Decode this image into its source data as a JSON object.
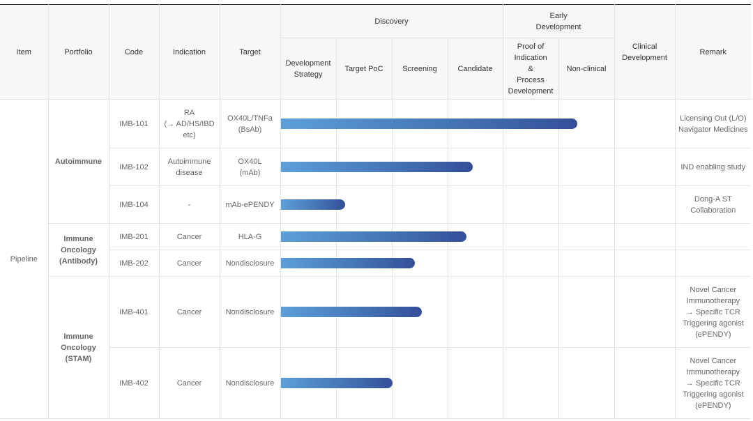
{
  "header": {
    "item": "Item",
    "portfolio": "Portfolio",
    "code": "Code",
    "indication": "Indication",
    "target": "Target",
    "discovery": "Discovery",
    "early_development": "Early\nDevelopment",
    "clinical_development": "Clinical\nDevelopment",
    "remark": "Remark",
    "sub": {
      "development_strategy": "Development\nStrategy",
      "target_poc": "Target PoC",
      "screening": "Screening",
      "candidate": "Candidate",
      "proof_of_indication": "Proof of\nIndication\n&\nProcess\nDevelopment",
      "non_clinical": "Non-clinical"
    }
  },
  "item_label": "Pipeline",
  "portfolios": {
    "autoimmune": "Autoimmune",
    "immune_oncology_antibody": "Immune\nOncology\n(Antibody)",
    "immune_oncology_stam": "Immune\nOncology\n(STAM)"
  },
  "rows": [
    {
      "code": "IMB-101",
      "indication": "RA\n(→ AD/HS/IBD\netc)",
      "target": "OX40L/TNFa\n(BsAb)",
      "remark": "Licensing Out (L/O)\nNavigator Medicines",
      "progress": 0.75
    },
    {
      "code": "IMB-102",
      "indication": "Autoimmune\ndisease",
      "target": "OX40L\n(mAb)",
      "remark": "IND enabling study",
      "progress": 0.485
    },
    {
      "code": "IMB-104",
      "indication": "-",
      "target": "mAb-ePENDY",
      "remark": "Dong-A ST\nCollaboration",
      "progress": 0.163
    },
    {
      "code": "IMB-201",
      "indication": "Cancer",
      "target": "HLA-G",
      "remark": "",
      "progress": 0.47
    },
    {
      "code": "IMB-202",
      "indication": "Cancer",
      "target": "Nondisclosure",
      "remark": "",
      "progress": 0.34
    },
    {
      "code": "IMB-401",
      "indication": "Cancer",
      "target": "Nondisclosure",
      "remark": "Novel Cancer\nImmunotherapy\n→ Specific TCR\nTriggering agonist\n(ePENDY)",
      "progress": 0.356
    },
    {
      "code": "IMB-402",
      "indication": "Cancer",
      "target": "Nondisclosure",
      "remark": "Novel Cancer\nImmunotherapy\n→ Specific TCR\nTriggering agonist\n(ePENDY)",
      "progress": 0.283
    }
  ]
}
